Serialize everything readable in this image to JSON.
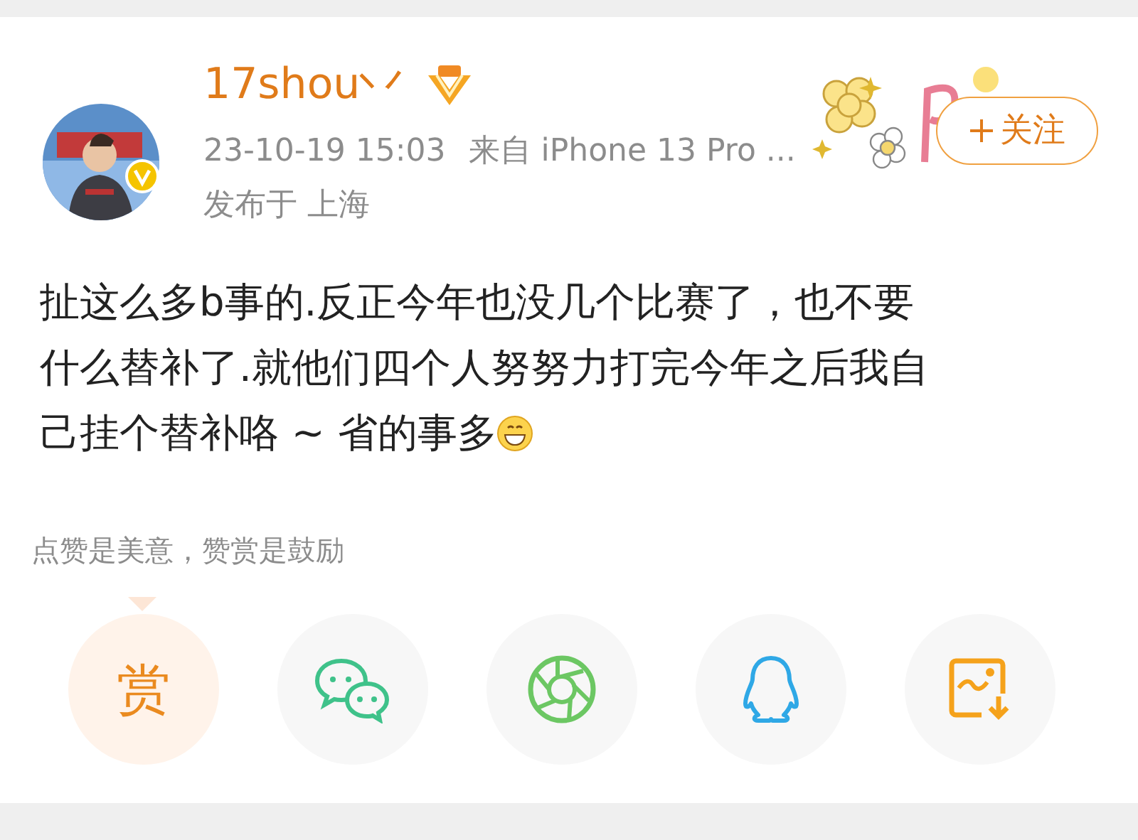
{
  "post": {
    "author": "17shou丷",
    "time": "23-10-19 15:03",
    "source": "来自 iPhone 13 Pro ...",
    "location": "发布于 上海",
    "follow": {
      "label": "关注",
      "following": false
    },
    "text_lines": [
      "扯这么多b事的.反正今年也没几个比赛了，也不要",
      "什么替补了.就他们四个人努努力打完今年之后我自",
      "己挂个替补咯 ~ 省的事多"
    ]
  },
  "reward_hint": "点赞是美意，赞赏是鼓励",
  "share_buttons": [
    {
      "kind": "reward",
      "label": "赏"
    },
    {
      "kind": "wechat"
    },
    {
      "kind": "moments"
    },
    {
      "kind": "qq"
    },
    {
      "kind": "save-image"
    }
  ]
}
